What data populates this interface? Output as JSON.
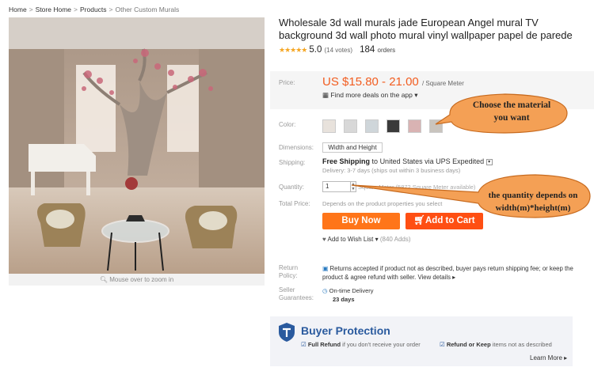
{
  "breadcrumb": [
    "Home",
    "Store Home",
    "Products",
    "Other Custom Murals"
  ],
  "gallery": {
    "zoom_hint": "Mouse over to zoom in"
  },
  "product": {
    "title": "Wholesale 3d wall murals jade European Angel mural TV background 3d wall photo mural vinyl wallpaper papel de parede",
    "rating": "5.0",
    "votes": "(14 votes)",
    "orders_count": "184",
    "orders_label": "orders"
  },
  "price": {
    "label": "Price:",
    "value": "US $15.80 - 21.00",
    "unit": "/ Square Meter",
    "deals": "Find more deals on the app"
  },
  "options": {
    "color_label": "Color:",
    "swatches": [
      "#e8e2dc",
      "#d8d8d8",
      "#cfd6da",
      "#3a3a3a",
      "#d9b3b3",
      "#c9c4be"
    ],
    "dimensions_label": "Dimensions:",
    "dimensions_value": "Width and Height",
    "shipping_label": "Shipping:",
    "shipping_free": "Free Shipping",
    "shipping_to": "to",
    "shipping_dest": "United States via UPS Expedited",
    "delivery": "Delivery: 3-7 days (ships out within 3 business days)",
    "quantity_label": "Quantity:",
    "quantity_value": "1",
    "available": "Square Meter (5872 Square Meter available)",
    "total_label": "Total Price:",
    "total_note": "Depends on the product properties you select"
  },
  "actions": {
    "buy_now": "Buy Now",
    "add_to_cart": "Add to Cart",
    "wishlist": "Add to Wish List",
    "wishlist_count": "(840 Adds)"
  },
  "policies": {
    "return_label": "Return Policy:",
    "return_text": "Returns accepted if product not as described, buyer pays return shipping fee; or keep the product & agree refund with seller.",
    "view_details": "View details",
    "seller_label": "Seller Guarantees:",
    "ontime": "On-time Delivery",
    "days": "23 days"
  },
  "buyer_protection": {
    "title": "Buyer Protection",
    "item1_bold": "Full Refund",
    "item1_rest": "if you don't receive your order",
    "item2_bold": "Refund or Keep",
    "item2_rest": "items not as described",
    "learn_more": "Learn More"
  },
  "callouts": {
    "material_line1": "Choose the material",
    "material_line2": "you want",
    "quantity_line1": "the quantity depends on",
    "quantity_line2": "width(m)*height(m)"
  },
  "colors": {
    "accent_orange": "#f25d20",
    "buy_now": "#ff7519",
    "add_to_cart": "#ff4f13",
    "callout_fill": "#f4a055",
    "protection_blue": "#2a5a9e"
  }
}
